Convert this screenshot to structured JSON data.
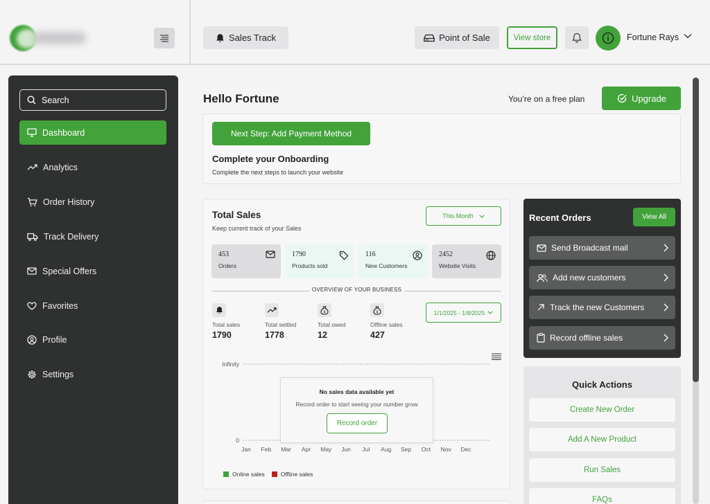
{
  "header": {
    "sales_track": "Sales Track",
    "point_of_sale": "Point of Sale",
    "view_store": "View store",
    "user_name": "Fortune Rays"
  },
  "sidebar": {
    "search_placeholder": "Search",
    "items": [
      {
        "label": "Dashboard",
        "icon": "monitor-icon",
        "active": true
      },
      {
        "label": "Analytics",
        "icon": "trend-up-icon"
      },
      {
        "label": "Order History",
        "icon": "cart-icon"
      },
      {
        "label": "Track Delivery",
        "icon": "truck-icon"
      },
      {
        "label": "Special Offers",
        "icon": "mail-icon"
      },
      {
        "label": "Favorites",
        "icon": "heart-icon"
      },
      {
        "label": "Profile",
        "icon": "user-circle-icon"
      },
      {
        "label": "Settings",
        "icon": "gear-icon"
      }
    ]
  },
  "main": {
    "greeting": "Hello Fortune",
    "plan_text": "You’re on a free plan",
    "upgrade_label": "Upgrade",
    "onboarding": {
      "next_step": "Next Step: Add Payment Method",
      "title": "Complete your Onboarding",
      "subtitle": "Complete the next steps to launch your website"
    },
    "total_sales": {
      "title": "Total Sales",
      "subtitle": "Keep current track of your Sales",
      "period": "This Month",
      "stats": [
        {
          "value": "453",
          "label": "Orders",
          "icon": "mail-icon",
          "bg": "#dddde0"
        },
        {
          "value": "1790",
          "label": "Products sold",
          "icon": "tag-icon",
          "bg": "#eaf7f2"
        },
        {
          "value": "116",
          "label": "New Customers",
          "icon": "user-circle-icon",
          "bg": "#eaf7f2"
        },
        {
          "value": "2452",
          "label": "Website Visits",
          "icon": "globe-icon",
          "bg": "#dddde0"
        }
      ],
      "overview_label": "OVERVIEW OF YOUR BUSINESS",
      "mini_stats": [
        {
          "label": "Total sales",
          "value": "1790",
          "icon": "bell-icon"
        },
        {
          "label": "Total settled",
          "value": "1778",
          "icon": "trend-up-icon"
        },
        {
          "label": "Total owed",
          "value": "12",
          "icon": "money-bag-icon"
        },
        {
          "label": "Offline sales",
          "value": "427",
          "icon": "money-bag-icon"
        }
      ],
      "date_range": "1/1/2025 - 1/8/2025",
      "empty_title": "No sales data available yet",
      "empty_sub": "Record order to start seeing your number grow",
      "record_label": "Record order"
    }
  },
  "chart_data": {
    "type": "line",
    "categories": [
      "Jan",
      "Feb",
      "Mar",
      "Apr",
      "May",
      "Jun",
      "Jul",
      "Aug",
      "Sep",
      "Oct",
      "Nov",
      "Dec"
    ],
    "y_tick_labels": [
      "Infinity",
      "0"
    ],
    "series": [
      {
        "name": "Online sales",
        "color": "#42a33a",
        "values": []
      },
      {
        "name": "Offline sales",
        "color": "#c0201b",
        "values": []
      }
    ],
    "grid": true,
    "legend": "bottom-left"
  },
  "recent_orders": {
    "title": "Recent Orders",
    "view_all": "View All",
    "actions": [
      {
        "label": "Send Broadcast mail",
        "icon": "mail-icon"
      },
      {
        "label": "Add new customers",
        "icon": "users-icon"
      },
      {
        "label": "Track the new Customers",
        "icon": "arrow-up-right-icon"
      },
      {
        "label": "Record offline sales",
        "icon": "clipboard-icon"
      }
    ]
  },
  "quick_actions": {
    "title": "Quick Actions",
    "items": [
      "Create New Order",
      "Add A New Product",
      "Run Sales",
      "FAQs"
    ]
  }
}
